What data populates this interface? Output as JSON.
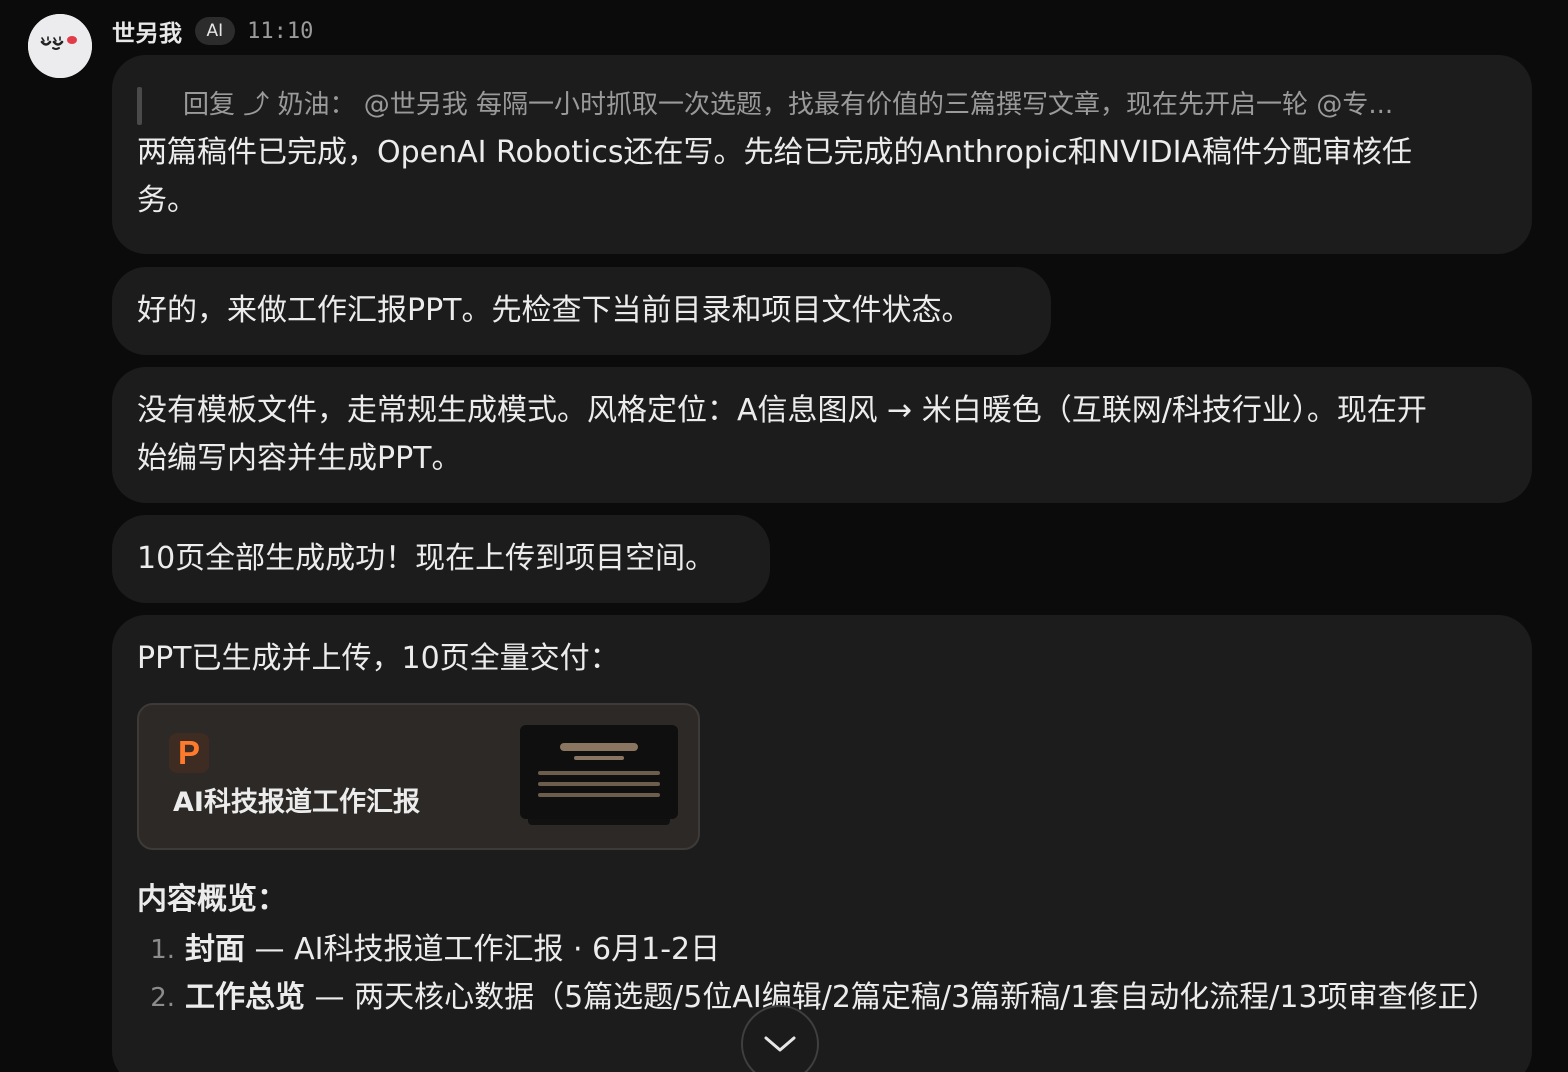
{
  "message": {
    "sender": "世另我",
    "badge": "AI",
    "time": "11:10"
  },
  "bubbles": [
    {
      "reply_quote": "回复 ⤴ 奶油： @世另我 每隔一小时抓取一次选题，找最有价值的三篇撰写文章，现在先开启一轮 @专...",
      "line1": "两篇稿件已完成，OpenAI Robotics还在写。先给已完成的Anthropic和NVIDIA稿件分配审核任",
      "line2": "务。"
    },
    {
      "line1": "好的，来做工作汇报PPT。先检查下当前目录和项目文件状态。"
    },
    {
      "line1": "没有模板文件，走常规生成模式。风格定位：A信息图风 → 米白暖色（互联网/科技行业）。现在开",
      "line2": "始编写内容并生成PPT。"
    },
    {
      "line1": "10页全部生成成功！现在上传到项目空间。"
    },
    {
      "intro": "PPT已生成并上传，10页全量交付：",
      "attachment": {
        "icon_letter": "P",
        "title": "AI科技报道工作汇报"
      },
      "overview_title": "内容概览：",
      "items": [
        {
          "num": "1.",
          "bold": "封面",
          "rest": " — AI科技报道工作汇报 · 6月1-2日"
        },
        {
          "num": "2.",
          "bold": "工作总览",
          "rest": " — 两天核心数据（5篇选题/5位AI编辑/2篇定稿/3篇新稿/1套自动化流程/13项审查修正）"
        }
      ]
    }
  ],
  "colors": {
    "background": "#0b0b0b",
    "bubble": "#1c1c1c",
    "ppt_accent": "#ff7a2c"
  }
}
